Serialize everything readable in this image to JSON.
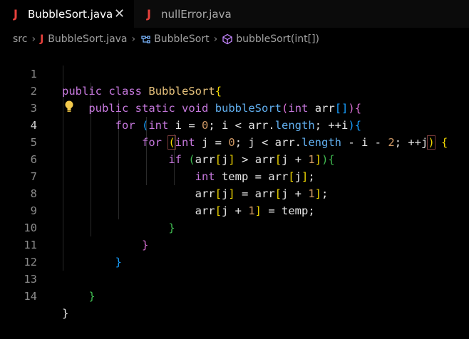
{
  "tabs": [
    {
      "icon": "J",
      "label": "BubbleSort.java",
      "active": true,
      "close": "✕"
    },
    {
      "icon": "J",
      "label": "nullError.java",
      "active": false
    }
  ],
  "breadcrumb": {
    "root": "src",
    "file": "BubbleSort.java",
    "class": "BubbleSort",
    "method": "bubbleSort(int[])"
  },
  "editor": {
    "current_line": 4,
    "line_numbers": [
      "1",
      "2",
      "3",
      "4",
      "5",
      "6",
      "7",
      "8",
      "9",
      "10",
      "11",
      "12",
      "13",
      "14"
    ],
    "lines": [
      "public class BubbleSort{",
      "    public static void bubbleSort(int arr[]){",
      "        for (int i = 0; i < arr.length; ++i){",
      "            for (int j = 0; j < arr.length - i - 2; ++j) {",
      "                if (arr[j] > arr[j + 1]){",
      "                    int temp = arr[j];",
      "                    arr[j] = arr[j + 1];",
      "                    arr[j + 1] = temp;",
      "                }",
      "            }",
      "        }",
      "",
      "    }",
      "}"
    ]
  },
  "colors": {
    "keyword": "#c678dd",
    "class": "#e5c07b",
    "function": "#61afef",
    "number": "#d19a66",
    "bracket_gold": "#f1d700",
    "bracket_purple": "#da70d6",
    "bracket_blue": "#179fff",
    "bracket_green": "#3fb950",
    "java_icon": "#e8413c"
  }
}
